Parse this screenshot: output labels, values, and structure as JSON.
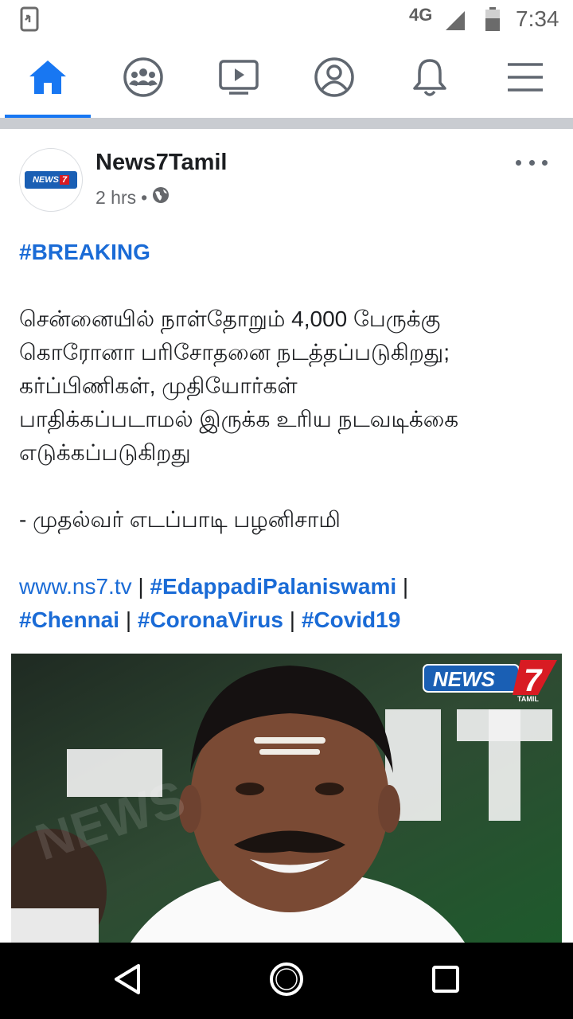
{
  "status_bar": {
    "network": "4G",
    "time": "7:34",
    "icons": [
      "screen-mirror-icon",
      "signal-icon",
      "battery-icon"
    ]
  },
  "nav": {
    "items": [
      {
        "name": "home-icon",
        "active": true
      },
      {
        "name": "groups-icon",
        "active": false
      },
      {
        "name": "watch-icon",
        "active": false
      },
      {
        "name": "profile-icon",
        "active": false
      },
      {
        "name": "notifications-icon",
        "active": false
      },
      {
        "name": "menu-icon",
        "active": false
      }
    ],
    "accent": "#1877f2"
  },
  "post": {
    "author": "News7Tamil",
    "time": "2 hrs",
    "separator": "•",
    "privacy_icon": "globe-icon",
    "breaking": "#BREAKING",
    "body_lines": [
      "சென்னையில் நாள்தோறும் 4,000 பேருக்கு",
      "கொரோனா பரிசோதனை நடத்தப்படுகிறது;",
      "கர்ப்பிணிகள், முதியோர்கள்",
      "பாதிக்கப்படாமல் இருக்க உரிய நடவடிக்கை",
      "எடுக்கப்படுகிறது"
    ],
    "quote": "- முதல்வர் எடப்பாடி பழனிசாமி",
    "link": "www.ns7.tv",
    "pipe": "|",
    "tags": [
      "#EdappadiPalaniswami",
      "#Chennai",
      "#CoronaVirus",
      "#Covid19"
    ],
    "image": {
      "logo_text": "NEWS",
      "logo_number": "7",
      "logo_sub": "TAMIL",
      "watermark": "NEWS"
    }
  },
  "colors": {
    "link": "#1a6bd6",
    "text": "#1c1e21",
    "meta": "#65676b"
  }
}
